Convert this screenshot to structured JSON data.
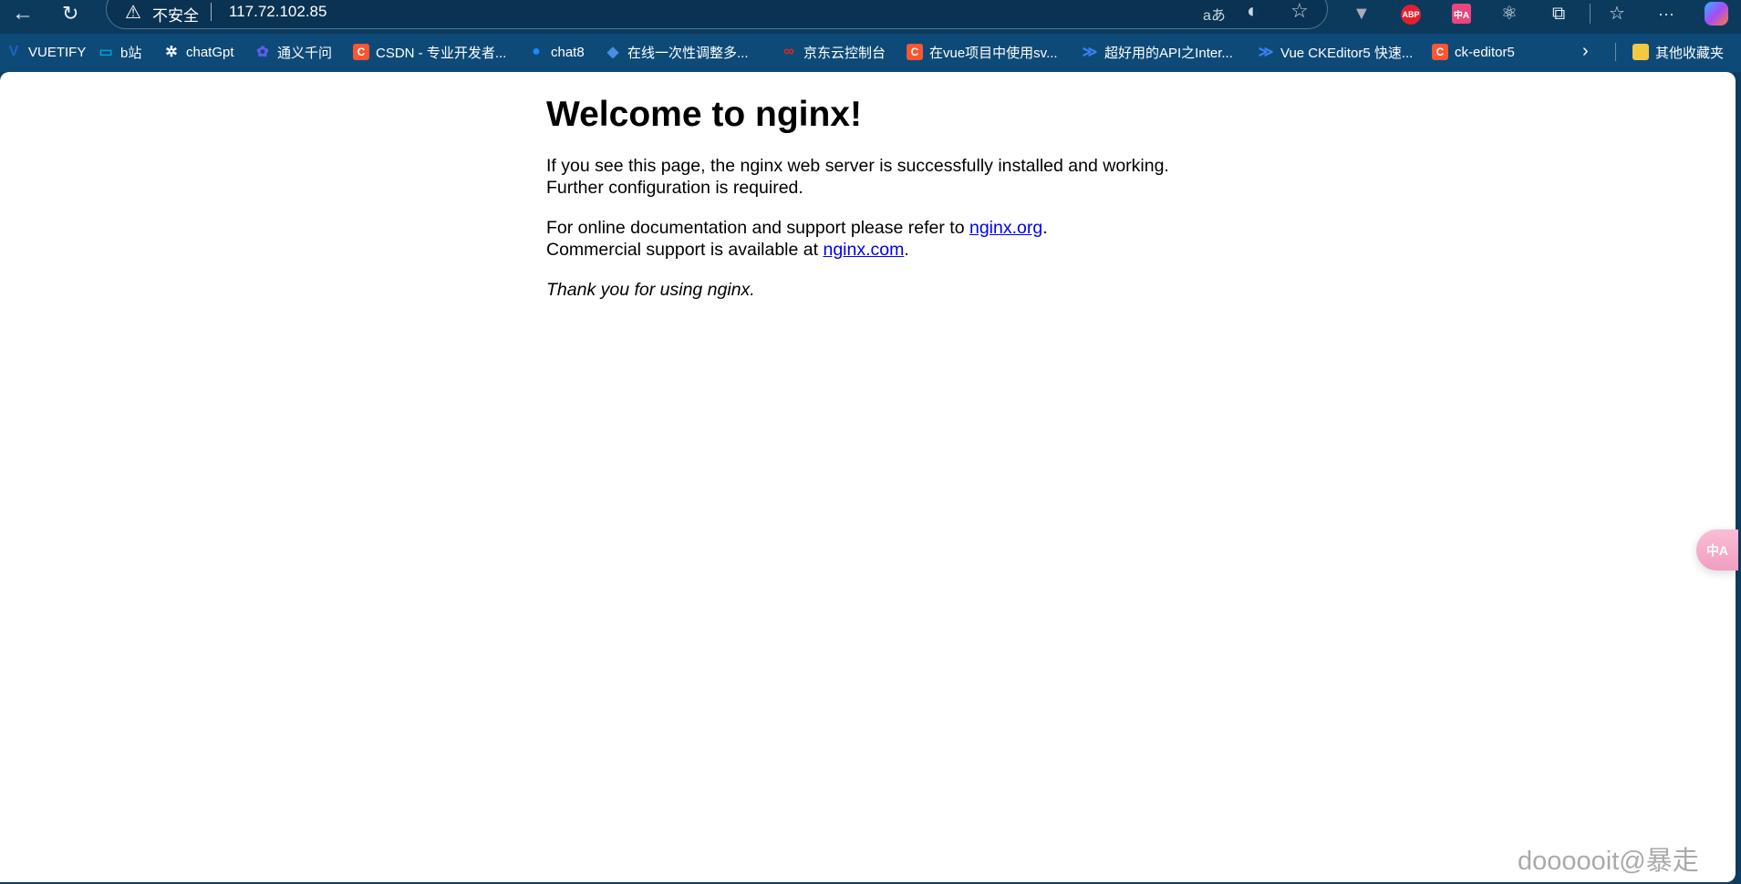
{
  "toolbar": {
    "back_icon": "arrow-left-icon",
    "reload_icon": "reload-icon",
    "security_label": "不安全",
    "url": "117.72.102.85",
    "read_aloud_label": "aあ",
    "extensions": [
      "vuetify-devtools",
      "adblock-plus",
      "translate",
      "react-devtools",
      "extensions-puzzle"
    ],
    "abp_label": "ABP",
    "translate_label": "中A",
    "more_label": "···"
  },
  "bookmarks": [
    {
      "label": "VUETIFY",
      "icon": "V",
      "color": "#1867c0"
    },
    {
      "label": "b站",
      "icon": "▭",
      "color": "#00a1d6"
    },
    {
      "label": "chatGpt",
      "icon": "✲",
      "color": "#ffffff"
    },
    {
      "label": "通义千问",
      "icon": "✿",
      "color": "#615ced"
    },
    {
      "label": "CSDN - 专业开发者...",
      "icon": "C",
      "color": "#fc5531"
    },
    {
      "label": "chat8",
      "icon": "●",
      "color": "#1e88ff"
    },
    {
      "label": "在线一次性调整多...",
      "icon": "◆",
      "color": "#4a90e2"
    },
    {
      "label": "京东云控制台",
      "icon": "∞",
      "color": "#e1251b"
    },
    {
      "label": "在vue项目中使用sv...",
      "icon": "C",
      "color": "#fc5531"
    },
    {
      "label": "超好用的API之Inter...",
      "icon": "≫",
      "color": "#3b82f6"
    },
    {
      "label": "Vue CKEditor5 快速...",
      "icon": "≫",
      "color": "#3b82f6"
    },
    {
      "label": "ck-editor5",
      "icon": "C",
      "color": "#fc5531"
    }
  ],
  "other_bookmarks": "其他收藏夹",
  "page": {
    "title": "Welcome to nginx!",
    "p1": "If you see this page, the nginx web server is successfully installed and working. Further configuration is required.",
    "p2_prefix": "For online documentation and support please refer to ",
    "link_org": "nginx.org",
    "p2_mid": ".",
    "p2_line2": "Commercial support is available at ",
    "link_com": "nginx.com",
    "p2_end": ".",
    "p3": "Thank you for using nginx."
  },
  "watermark": "doooooit@暴走",
  "floating_translate": "中A"
}
